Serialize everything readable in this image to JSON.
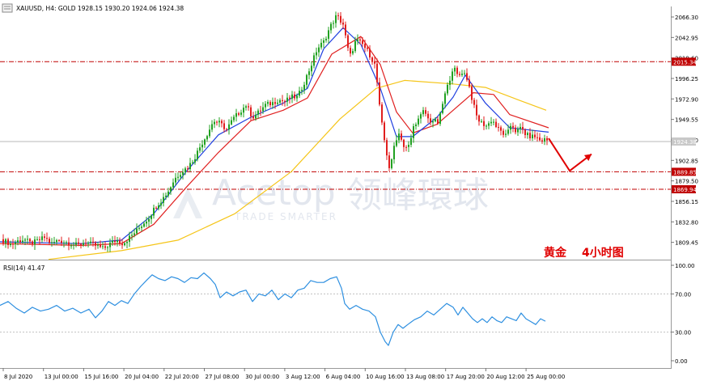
{
  "window": {
    "symbol_line": "XAUUSD, H4:  GOLD  1928.15 1930.20 1924.06 1924.38"
  },
  "watermark": {
    "brand_en": "Acetop",
    "brand_cn": "领峰環球",
    "tagline": "TRADE SMARTER"
  },
  "annotation": {
    "text_a": "黄金",
    "text_b": "4小时图"
  },
  "colors": {
    "bull": "#21a121",
    "bear": "#e01e1e",
    "ma_fast": "#1f3fe0",
    "ma_mid": "#e02020",
    "ma_slow": "#f5c518",
    "rsi": "#2d8fe0",
    "level": "#c00000",
    "arrow": "#e00000"
  },
  "chart_data": [
    {
      "type": "candlestick",
      "symbol": "XAUUSD",
      "timeframe": "H4",
      "ohlc_last": {
        "open": 1928.15,
        "high": 1930.2,
        "low": 1924.06,
        "close": 1924.38
      },
      "y_ticks": [
        "2066.30",
        "2042.95",
        "2019.60",
        "1996.25",
        "1972.90",
        "1949.55",
        "1926.20",
        "1902.85",
        "1879.50",
        "1856.15",
        "1832.80",
        "1809.45"
      ],
      "ylim": [
        1788,
        2077
      ],
      "x_ticks": [
        "8 Jul 2020",
        "13 Jul 00:00",
        "15 Jul 16:00",
        "20 Jul 04:00",
        "22 Jul 20:00",
        "27 Jul 08:00",
        "30 Jul 00:00",
        "3 Aug 12:00",
        "6 Aug 04:00",
        "10 Aug 16:00",
        "13 Aug 08:00",
        "17 Aug 20:00",
        "20 Aug 12:00",
        "25 Aug 00:00"
      ],
      "levels": [
        {
          "label": "2015.34",
          "value": 2015.34
        },
        {
          "label": "1889.85",
          "value": 1889.85
        },
        {
          "label": "1869.94",
          "value": 1869.94
        }
      ],
      "current_price": {
        "label": "1924.38",
        "value": 1924.38
      },
      "close_path": [
        [
          0,
          1813
        ],
        [
          8,
          1810
        ],
        [
          14,
          1807
        ],
        [
          22,
          1811
        ],
        [
          30,
          1813
        ],
        [
          38,
          1808
        ],
        [
          46,
          1811
        ],
        [
          55,
          1815
        ],
        [
          64,
          1808
        ],
        [
          72,
          1812
        ],
        [
          80,
          1810
        ],
        [
          88,
          1808
        ],
        [
          96,
          1806
        ],
        [
          105,
          1810
        ],
        [
          113,
          1807
        ],
        [
          121,
          1805
        ],
        [
          128,
          1802
        ],
        [
          136,
          1808
        ],
        [
          144,
          1812
        ],
        [
          152,
          1808
        ],
        [
          160,
          1815
        ],
        [
          168,
          1822
        ],
        [
          176,
          1830
        ],
        [
          184,
          1838
        ],
        [
          192,
          1850
        ],
        [
          200,
          1858
        ],
        [
          208,
          1868
        ],
        [
          216,
          1882
        ],
        [
          224,
          1890
        ],
        [
          232,
          1895
        ],
        [
          240,
          1905
        ],
        [
          248,
          1920
        ],
        [
          256,
          1933
        ],
        [
          264,
          1948
        ],
        [
          272,
          1945
        ],
        [
          280,
          1938
        ],
        [
          288,
          1950
        ],
        [
          296,
          1958
        ],
        [
          304,
          1966
        ],
        [
          312,
          1952
        ],
        [
          320,
          1958
        ],
        [
          328,
          1966
        ],
        [
          336,
          1968
        ],
        [
          344,
          1972
        ],
        [
          352,
          1970
        ],
        [
          360,
          1975
        ],
        [
          368,
          1975
        ],
        [
          376,
          1992
        ],
        [
          384,
          2010
        ],
        [
          392,
          2030
        ],
        [
          400,
          2038
        ],
        [
          408,
          2055
        ],
        [
          416,
          2068
        ],
        [
          424,
          2058
        ],
        [
          432,
          2020
        ],
        [
          440,
          2040
        ],
        [
          448,
          2035
        ],
        [
          456,
          2025
        ],
        [
          464,
          2010
        ],
        [
          470,
          1955
        ],
        [
          476,
          1920
        ],
        [
          482,
          1890
        ],
        [
          488,
          1925
        ],
        [
          494,
          1935
        ],
        [
          500,
          1915
        ],
        [
          506,
          1920
        ],
        [
          512,
          1945
        ],
        [
          518,
          1950
        ],
        [
          524,
          1960
        ],
        [
          530,
          1948
        ],
        [
          536,
          1948
        ],
        [
          542,
          1945
        ],
        [
          548,
          1972
        ],
        [
          554,
          1990
        ],
        [
          560,
          2010
        ],
        [
          566,
          1998
        ],
        [
          572,
          2005
        ],
        [
          578,
          1995
        ],
        [
          584,
          1970
        ],
        [
          590,
          1950
        ],
        [
          596,
          1945
        ],
        [
          602,
          1942
        ],
        [
          608,
          1950
        ],
        [
          614,
          1940
        ],
        [
          620,
          1935
        ],
        [
          626,
          1930
        ],
        [
          632,
          1945
        ],
        [
          638,
          1935
        ],
        [
          644,
          1940
        ],
        [
          650,
          1932
        ],
        [
          656,
          1930
        ],
        [
          662,
          1930
        ],
        [
          668,
          1925
        ],
        [
          674,
          1927
        ],
        [
          678,
          1924.38
        ]
      ],
      "ma_fast": [
        [
          0,
          1810
        ],
        [
          100,
          1808
        ],
        [
          150,
          1812
        ],
        [
          190,
          1842
        ],
        [
          230,
          1890
        ],
        [
          270,
          1932
        ],
        [
          310,
          1952
        ],
        [
          350,
          1968
        ],
        [
          380,
          1985
        ],
        [
          400,
          2030
        ],
        [
          424,
          2054
        ],
        [
          446,
          2035
        ],
        [
          470,
          1985
        ],
        [
          490,
          1930
        ],
        [
          510,
          1930
        ],
        [
          540,
          1952
        ],
        [
          560,
          1975
        ],
        [
          575,
          2000
        ],
        [
          600,
          1968
        ],
        [
          630,
          1940
        ],
        [
          678,
          1935
        ]
      ],
      "ma_mid": [
        [
          0,
          1808
        ],
        [
          100,
          1806
        ],
        [
          150,
          1808
        ],
        [
          190,
          1830
        ],
        [
          230,
          1872
        ],
        [
          270,
          1912
        ],
        [
          310,
          1948
        ],
        [
          350,
          1960
        ],
        [
          380,
          1974
        ],
        [
          410,
          2024
        ],
        [
          446,
          2044
        ],
        [
          470,
          2012
        ],
        [
          490,
          1958
        ],
        [
          510,
          1934
        ],
        [
          540,
          1944
        ],
        [
          560,
          1960
        ],
        [
          585,
          1980
        ],
        [
          610,
          1978
        ],
        [
          630,
          1955
        ],
        [
          678,
          1940
        ]
      ],
      "ma_slow": [
        [
          60,
          1790
        ],
        [
          150,
          1800
        ],
        [
          220,
          1812
        ],
        [
          290,
          1842
        ],
        [
          360,
          1890
        ],
        [
          420,
          1950
        ],
        [
          465,
          1985
        ],
        [
          500,
          1994
        ],
        [
          560,
          1990
        ],
        [
          600,
          1986
        ],
        [
          640,
          1972
        ],
        [
          675,
          1960
        ]
      ],
      "forecast_arrow": [
        [
          678,
          1928
        ],
        [
          704,
          1891
        ],
        [
          731,
          1910
        ]
      ]
    },
    {
      "type": "line",
      "name": "RSI(14)",
      "title": "RSI(14) 41.47",
      "last_value": 41.47,
      "y_ticks": [
        "100.00",
        "70.00",
        "30.00",
        "0.00"
      ],
      "levels": [
        70,
        30
      ],
      "ylim": [
        0,
        100
      ],
      "values": [
        [
          0,
          58
        ],
        [
          10,
          62
        ],
        [
          20,
          55
        ],
        [
          30,
          50
        ],
        [
          40,
          56
        ],
        [
          50,
          52
        ],
        [
          60,
          54
        ],
        [
          70,
          58
        ],
        [
          80,
          52
        ],
        [
          90,
          55
        ],
        [
          100,
          50
        ],
        [
          110,
          54
        ],
        [
          118,
          45
        ],
        [
          126,
          52
        ],
        [
          134,
          62
        ],
        [
          142,
          58
        ],
        [
          150,
          63
        ],
        [
          158,
          60
        ],
        [
          166,
          70
        ],
        [
          174,
          78
        ],
        [
          182,
          85
        ],
        [
          188,
          90
        ],
        [
          196,
          86
        ],
        [
          204,
          84
        ],
        [
          212,
          88
        ],
        [
          220,
          86
        ],
        [
          228,
          82
        ],
        [
          236,
          87
        ],
        [
          244,
          86
        ],
        [
          252,
          92
        ],
        [
          260,
          86
        ],
        [
          266,
          80
        ],
        [
          272,
          66
        ],
        [
          280,
          72
        ],
        [
          288,
          68
        ],
        [
          296,
          72
        ],
        [
          304,
          74
        ],
        [
          312,
          62
        ],
        [
          320,
          70
        ],
        [
          328,
          68
        ],
        [
          336,
          74
        ],
        [
          344,
          64
        ],
        [
          352,
          70
        ],
        [
          360,
          66
        ],
        [
          368,
          74
        ],
        [
          376,
          76
        ],
        [
          384,
          84
        ],
        [
          392,
          82
        ],
        [
          400,
          82
        ],
        [
          408,
          86
        ],
        [
          416,
          88
        ],
        [
          422,
          76
        ],
        [
          426,
          60
        ],
        [
          432,
          54
        ],
        [
          440,
          58
        ],
        [
          448,
          54
        ],
        [
          456,
          52
        ],
        [
          464,
          46
        ],
        [
          470,
          30
        ],
        [
          476,
          20
        ],
        [
          480,
          16
        ],
        [
          486,
          30
        ],
        [
          492,
          38
        ],
        [
          498,
          34
        ],
        [
          504,
          38
        ],
        [
          512,
          43
        ],
        [
          520,
          46
        ],
        [
          528,
          52
        ],
        [
          536,
          48
        ],
        [
          544,
          54
        ],
        [
          552,
          60
        ],
        [
          560,
          56
        ],
        [
          566,
          48
        ],
        [
          572,
          56
        ],
        [
          578,
          50
        ],
        [
          584,
          44
        ],
        [
          590,
          40
        ],
        [
          596,
          44
        ],
        [
          602,
          40
        ],
        [
          608,
          46
        ],
        [
          614,
          42
        ],
        [
          620,
          40
        ],
        [
          626,
          46
        ],
        [
          632,
          44
        ],
        [
          638,
          42
        ],
        [
          644,
          50
        ],
        [
          650,
          44
        ],
        [
          656,
          41
        ],
        [
          662,
          38
        ],
        [
          668,
          44
        ],
        [
          674,
          41.47
        ]
      ]
    }
  ]
}
